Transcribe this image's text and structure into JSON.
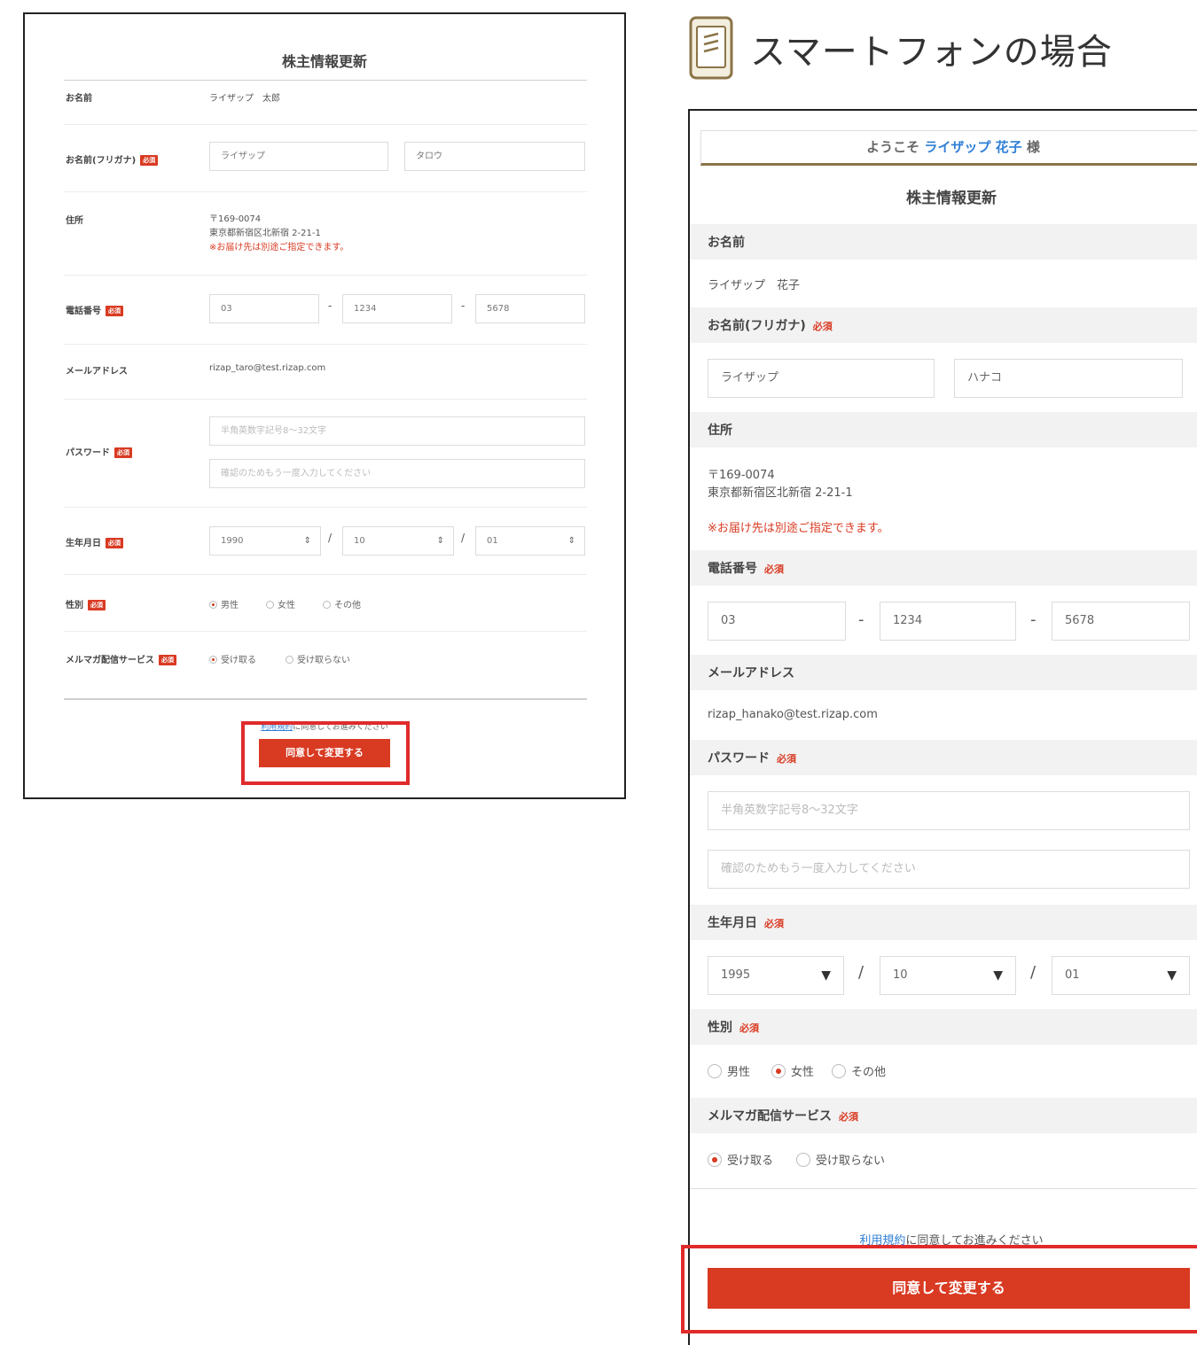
{
  "pc": {
    "title": "株主情報更新",
    "name_label": "お名前",
    "name_value": "ライザップ　太郎",
    "kana_label": "お名前(フリガナ)",
    "required_badge": "必須",
    "kana_sei": "ライザップ",
    "kana_mei": "タロウ",
    "address_label": "住所",
    "address_zip": "〒169-0074",
    "address_line": "東京都新宿区北新宿 2-21-1",
    "address_note": "※お届け先は別途ご指定できます。",
    "phone_label": "電話番号",
    "phone_1": "03",
    "phone_2": "1234",
    "phone_3": "5678",
    "phone_sep": "-",
    "email_label": "メールアドレス",
    "email_value": "rizap_taro@test.rizap.com",
    "password_label": "パスワード",
    "password_placeholder": "半角英数字記号8〜32文字",
    "password_confirm_placeholder": "確認のためもう一度入力してください",
    "birth_label": "生年月日",
    "birth_year": "1990",
    "birth_month": "10",
    "birth_day": "01",
    "date_sep": "/",
    "gender_label": "性別",
    "gender_options": [
      "男性",
      "女性",
      "その他"
    ],
    "mail_label": "メルマガ配信サービス",
    "mail_options": [
      "受け取る",
      "受け取らない"
    ],
    "terms_link": "利用規約",
    "terms_rest": "に同意してお進みください",
    "submit": "同意して変更する"
  },
  "sp_heading": "スマートフォンの場合",
  "sp": {
    "welcome_prefix": "ようこそ",
    "welcome_name": "ライザップ 花子",
    "welcome_suffix": "様",
    "title": "株主情報更新",
    "name_label": "お名前",
    "name_value": "ライザップ　花子",
    "kana_label": "お名前(フリガナ)",
    "required": "必須",
    "kana_sei": "ライザップ",
    "kana_mei": "ハナコ",
    "address_label": "住所",
    "address_zip": "〒169-0074",
    "address_line": "東京都新宿区北新宿 2-21-1",
    "address_note": "※お届け先は別途ご指定できます。",
    "phone_label": "電話番号",
    "phone_1": "03",
    "phone_2": "1234",
    "phone_3": "5678",
    "phone_sep": "-",
    "email_label": "メールアドレス",
    "email_value": "rizap_hanako@test.rizap.com",
    "password_label": "パスワード",
    "password_placeholder": "半角英数字記号8〜32文字",
    "password_confirm_placeholder": "確認のためもう一度入力してください",
    "birth_label": "生年月日",
    "birth_year": "1995",
    "birth_month": "10",
    "birth_day": "01",
    "date_sep": "/",
    "gender_label": "性別",
    "gender_options": [
      "男性",
      "女性",
      "その他"
    ],
    "mail_label": "メルマガ配信サービス",
    "mail_options": [
      "受け取る",
      "受け取らない"
    ],
    "terms_link": "利用規約",
    "terms_rest": "に同意してお進みください",
    "submit": "同意して変更する"
  },
  "colors": {
    "accent": "#d93a22",
    "highlight": "#e02b2b",
    "link": "#2f7fd6",
    "gold": "#8b7448"
  },
  "icons": [
    "smartphone-icon",
    "select-arrow-icon"
  ]
}
